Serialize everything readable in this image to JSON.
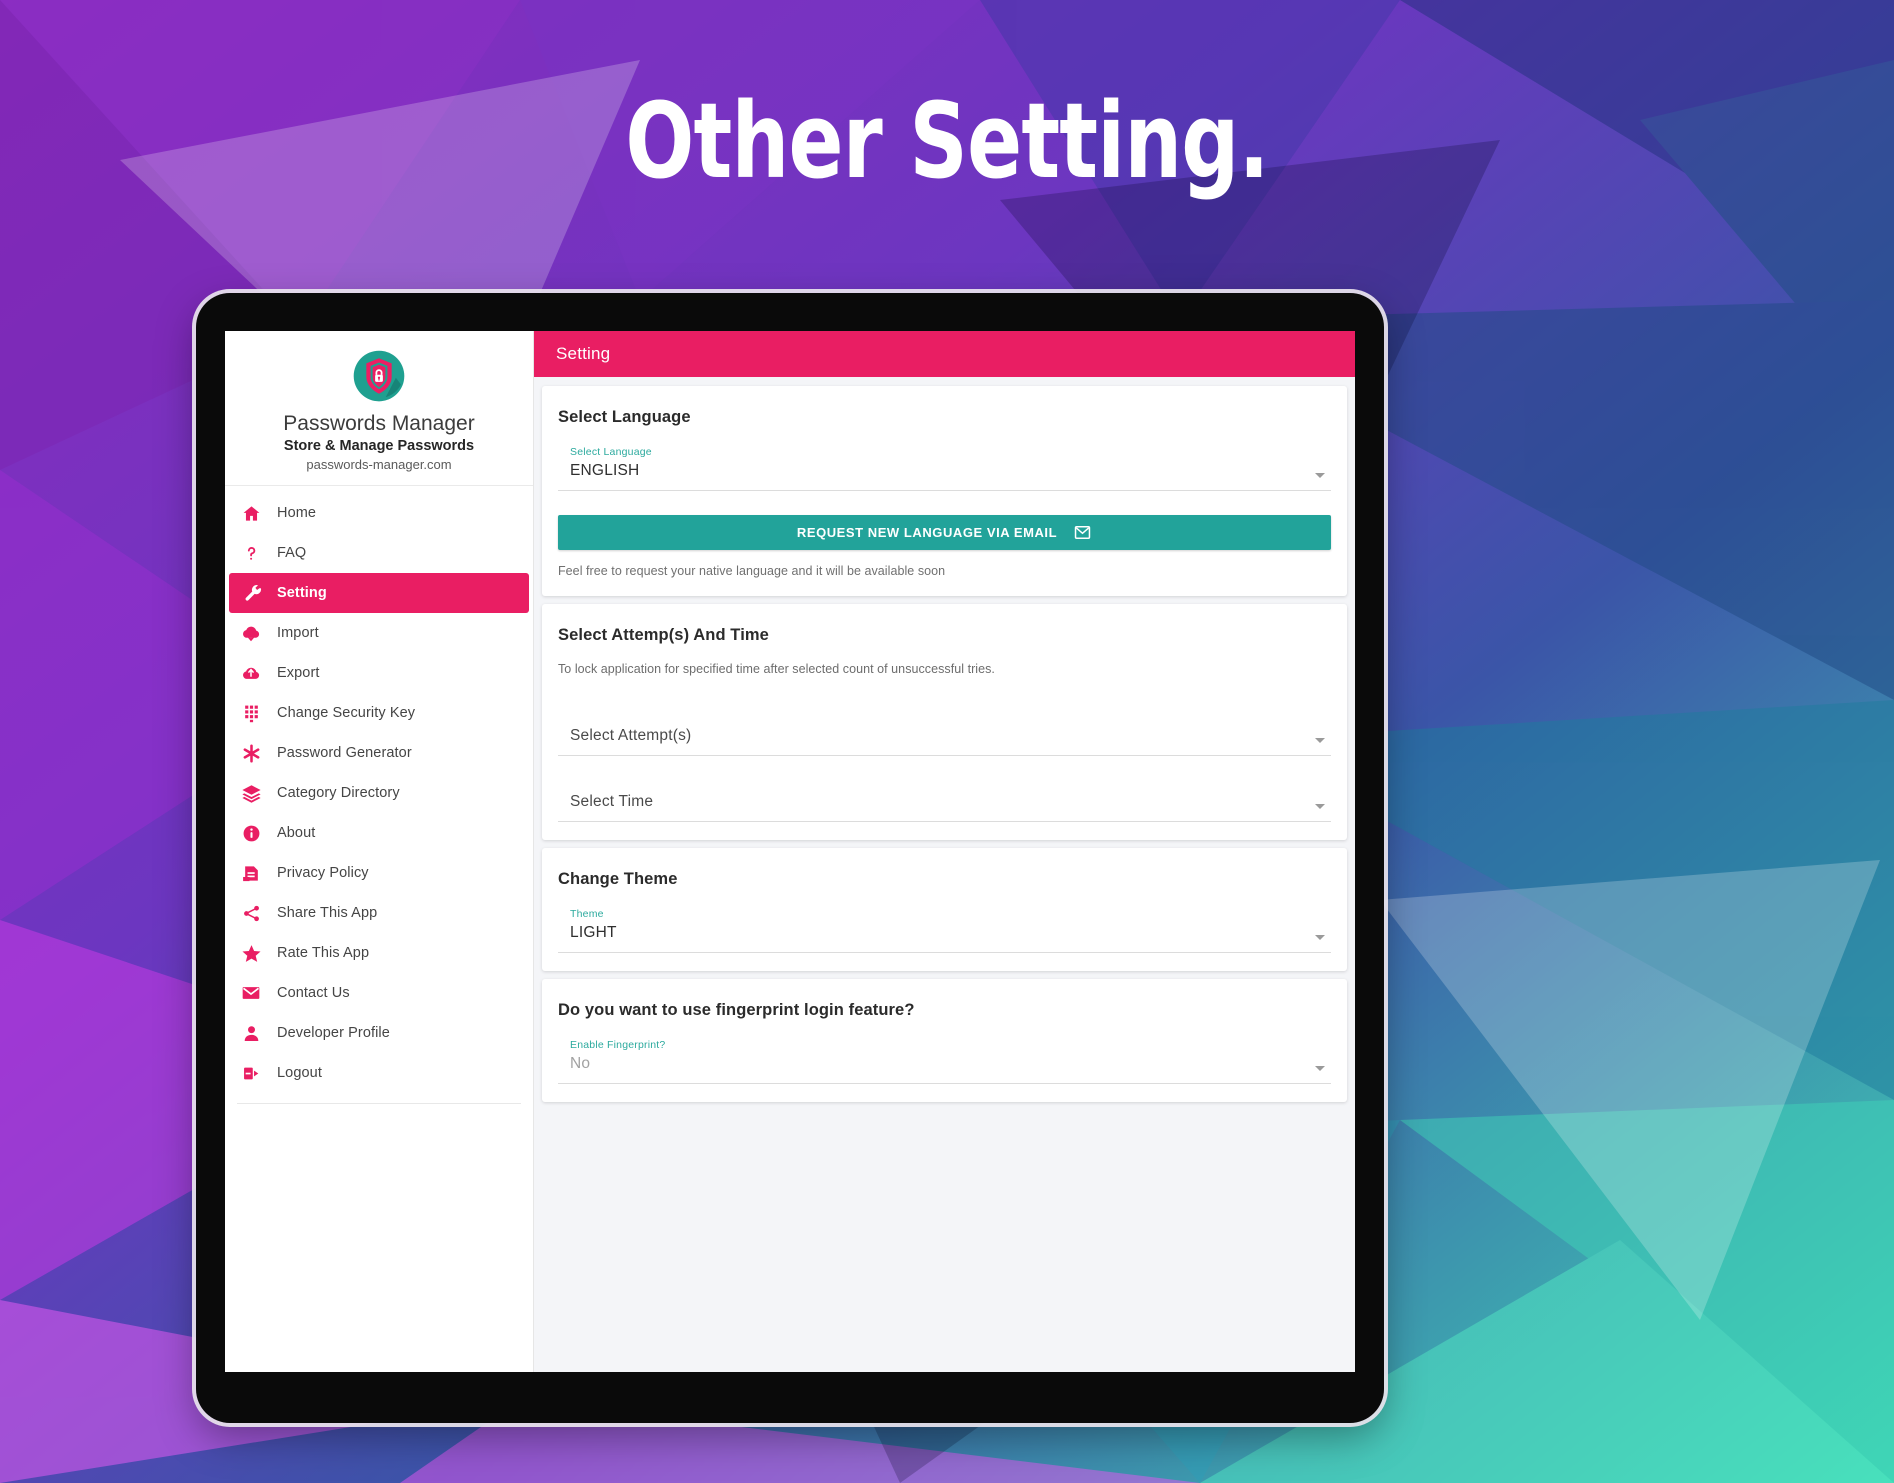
{
  "hero": {
    "title": "Other Setting."
  },
  "brand": {
    "name": "Passwords Manager",
    "tagline": "Store & Manage Passwords",
    "url": "passwords-manager.com",
    "logo_icon": "shield-lock-icon",
    "logo_circle_color": "#1FA090",
    "logo_shield_color": "#EC1E63"
  },
  "theme_colors": {
    "accent_pink": "#E91E63",
    "accent_teal": "#22A39A",
    "label_teal": "#2CAA9E",
    "content_bg": "#F4F5F8",
    "bezel": "#0A0A0A"
  },
  "sidebar": {
    "items": [
      {
        "label": "Home",
        "icon": "home-icon",
        "active": false
      },
      {
        "label": "FAQ",
        "icon": "question-mark-icon",
        "active": false
      },
      {
        "label": "Setting",
        "icon": "wrench-icon",
        "active": true
      },
      {
        "label": "Import",
        "icon": "cloud-download-icon",
        "active": false
      },
      {
        "label": "Export",
        "icon": "cloud-upload-icon",
        "active": false
      },
      {
        "label": "Change Security Key",
        "icon": "keypad-icon",
        "active": false
      },
      {
        "label": "Password Generator",
        "icon": "asterisk-icon",
        "active": false
      },
      {
        "label": "Category Directory",
        "icon": "layers-icon",
        "active": false
      },
      {
        "label": "About",
        "icon": "info-circle-icon",
        "active": false
      },
      {
        "label": "Privacy Policy",
        "icon": "document-icon",
        "active": false
      },
      {
        "label": "Share This App",
        "icon": "share-icon",
        "active": false
      },
      {
        "label": "Rate This App",
        "icon": "star-icon",
        "active": false
      },
      {
        "label": "Contact Us",
        "icon": "envelope-icon",
        "active": false
      },
      {
        "label": "Developer Profile",
        "icon": "person-icon",
        "active": false
      },
      {
        "label": "Logout",
        "icon": "logout-icon",
        "active": false
      }
    ]
  },
  "topbar": {
    "title": "Setting"
  },
  "cards": {
    "language": {
      "title": "Select Language",
      "select_label": "Select Language",
      "select_value": "ENGLISH",
      "button_label": "REQUEST NEW LANGUAGE VIA EMAIL",
      "button_icon": "envelope-icon",
      "helper": "Feel free to request your native language and it will be available soon"
    },
    "attempts": {
      "title": "Select Attemp(s) And Time",
      "subtitle": "To lock application for specified time after selected count of unsuccessful tries.",
      "attempt_placeholder": "Select Attempt(s)",
      "time_placeholder": "Select Time"
    },
    "theme": {
      "title": "Change Theme",
      "select_label": "Theme",
      "select_value": "LIGHT"
    },
    "fingerprint": {
      "title": "Do you want to use fingerprint login feature?",
      "select_label": "Enable Fingerprint?",
      "select_value": "No"
    }
  }
}
